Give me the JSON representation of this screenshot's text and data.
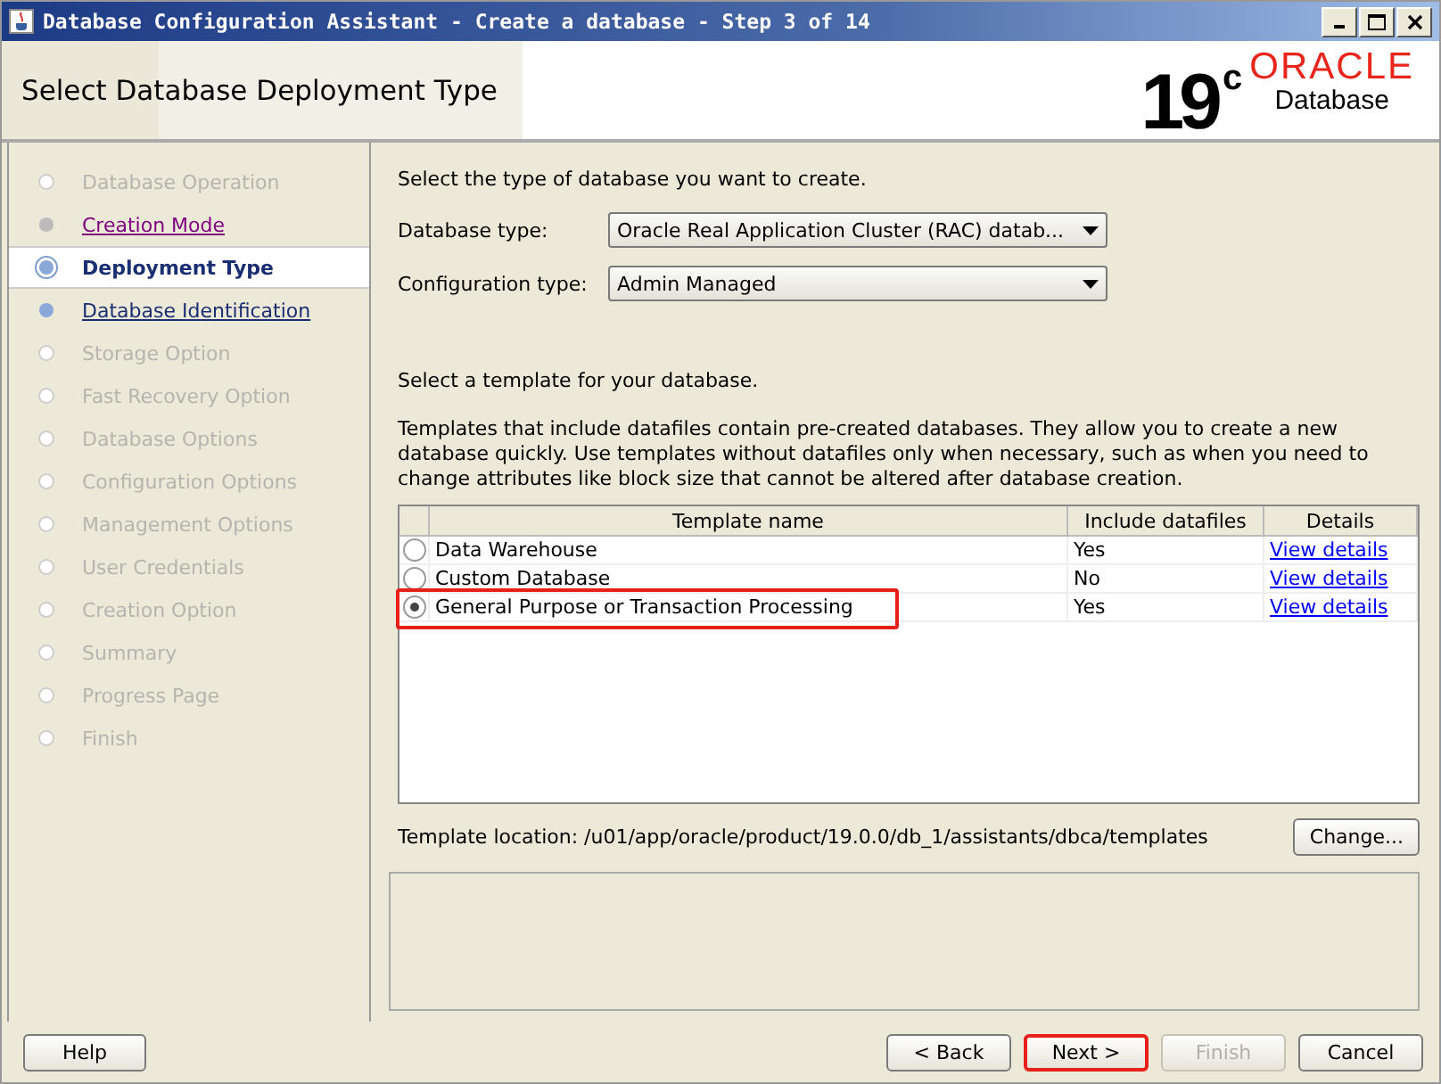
{
  "window": {
    "title": "Database Configuration Assistant - Create a database - Step 3 of 14"
  },
  "header": {
    "title": "Select Database Deployment Type",
    "logo_version": "19",
    "logo_suffix": "c",
    "logo_brand": "ORACLE",
    "logo_product": "Database"
  },
  "steps": [
    {
      "label": "Database Operation",
      "selected": false,
      "disabled": true,
      "visited": false
    },
    {
      "label": "Creation Mode",
      "selected": false,
      "disabled": false,
      "visited": true
    },
    {
      "label": "Deployment Type",
      "selected": true,
      "disabled": false,
      "visited": false
    },
    {
      "label": "Database Identification",
      "selected": false,
      "disabled": false,
      "visited": false
    },
    {
      "label": "Storage Option",
      "selected": false,
      "disabled": true,
      "visited": false
    },
    {
      "label": "Fast Recovery Option",
      "selected": false,
      "disabled": true,
      "visited": false
    },
    {
      "label": "Database Options",
      "selected": false,
      "disabled": true,
      "visited": false
    },
    {
      "label": "Configuration Options",
      "selected": false,
      "disabled": true,
      "visited": false
    },
    {
      "label": "Management Options",
      "selected": false,
      "disabled": true,
      "visited": false
    },
    {
      "label": "User Credentials",
      "selected": false,
      "disabled": true,
      "visited": false
    },
    {
      "label": "Creation Option",
      "selected": false,
      "disabled": true,
      "visited": false
    },
    {
      "label": "Summary",
      "selected": false,
      "disabled": true,
      "visited": false
    },
    {
      "label": "Progress Page",
      "selected": false,
      "disabled": true,
      "visited": false
    },
    {
      "label": "Finish",
      "selected": false,
      "disabled": true,
      "visited": false
    }
  ],
  "intro": "Select the type of database you want to create.",
  "fields": [
    {
      "label": "Database type:",
      "value": "Oracle Real Application Cluster (RAC) datab..."
    },
    {
      "label": "Configuration type:",
      "value": "Admin Managed"
    }
  ],
  "template_prompt": "Select a template for your database.",
  "template_note": "Templates that include datafiles contain pre-created databases. They allow you to create a new database quickly. Use templates without datafiles only when necessary, such as when you need to change attributes like block size that cannot be altered after database creation.",
  "table": {
    "columns": [
      "Template name",
      "Include datafiles",
      "Details"
    ],
    "rows": [
      {
        "name": "Data Warehouse",
        "datafiles": "Yes",
        "details": "View details",
        "selected": false,
        "highlighted": false
      },
      {
        "name": "Custom Database",
        "datafiles": "No",
        "details": "View details",
        "selected": false,
        "highlighted": false
      },
      {
        "name": "General Purpose or Transaction Processing",
        "datafiles": "Yes",
        "details": "View details",
        "selected": true,
        "highlighted": true
      }
    ]
  },
  "template_location": "Template location: /u01/app/oracle/product/19.0.0/db_1/assistants/dbca/templates",
  "change_button": "Change...",
  "buttons": [
    {
      "label": "Help",
      "disabled": false,
      "highlighted": false
    },
    {
      "label": "< Back",
      "disabled": false,
      "highlighted": false
    },
    {
      "label": "Next >",
      "disabled": false,
      "highlighted": true
    },
    {
      "label": "Finish",
      "disabled": true,
      "highlighted": false
    },
    {
      "label": "Cancel",
      "disabled": false,
      "highlighted": false
    }
  ]
}
